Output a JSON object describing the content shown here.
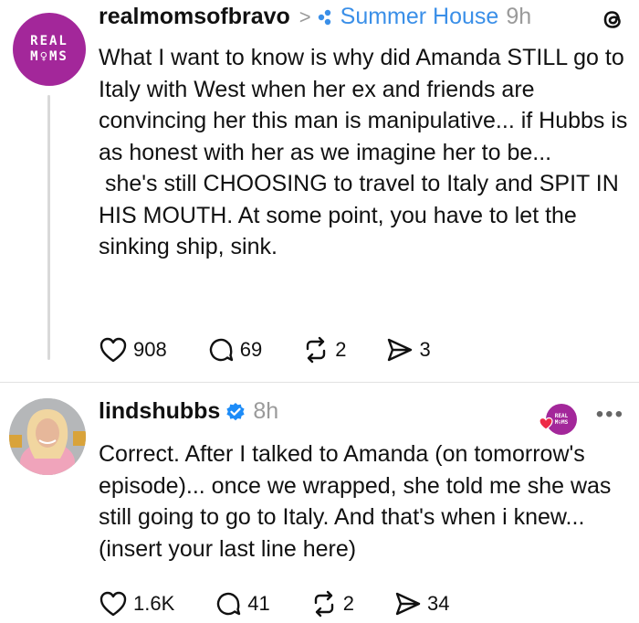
{
  "post1": {
    "avatar_text": [
      "REAL",
      "M♀MS"
    ],
    "username": "realmomsofbravo",
    "separator": ">",
    "community": "Summer House",
    "time": "9h",
    "body": [
      "What I want to know is why did Amanda STILL go to Italy with West when her ex and friends are convincing her this man is manipulative... if Hubbs is as honest with her as we imagine her to be...",
      " she's still CHOOSING to travel to Italy and SPIT IN HIS MOUTH. At some point, you have to let the sinking ship, sink."
    ],
    "likes": "908",
    "comments": "69",
    "reposts": "2",
    "shares": "3"
  },
  "post2": {
    "username": "lindshubbs",
    "time": "8h",
    "badge_text": [
      "REAL",
      "M♀MS"
    ],
    "more": "•••",
    "body": "Correct. After I talked to Amanda (on tomorrow's episode)... once we wrapped, she told me she was still going to go to Italy. And that's when i knew... (insert your last line here)",
    "likes": "1.6K",
    "comments": "41",
    "reposts": "2",
    "shares": "34"
  },
  "colors": {
    "brand_purple": "#a3279a",
    "link_blue": "#3a8fe8",
    "verified_blue": "#1d8cf8",
    "muted": "#9a9a9a"
  },
  "icons": [
    "threads-logo-icon",
    "heart-icon",
    "comment-icon",
    "repost-icon",
    "share-icon",
    "verified-icon",
    "community-dots-icon",
    "more-icon"
  ]
}
